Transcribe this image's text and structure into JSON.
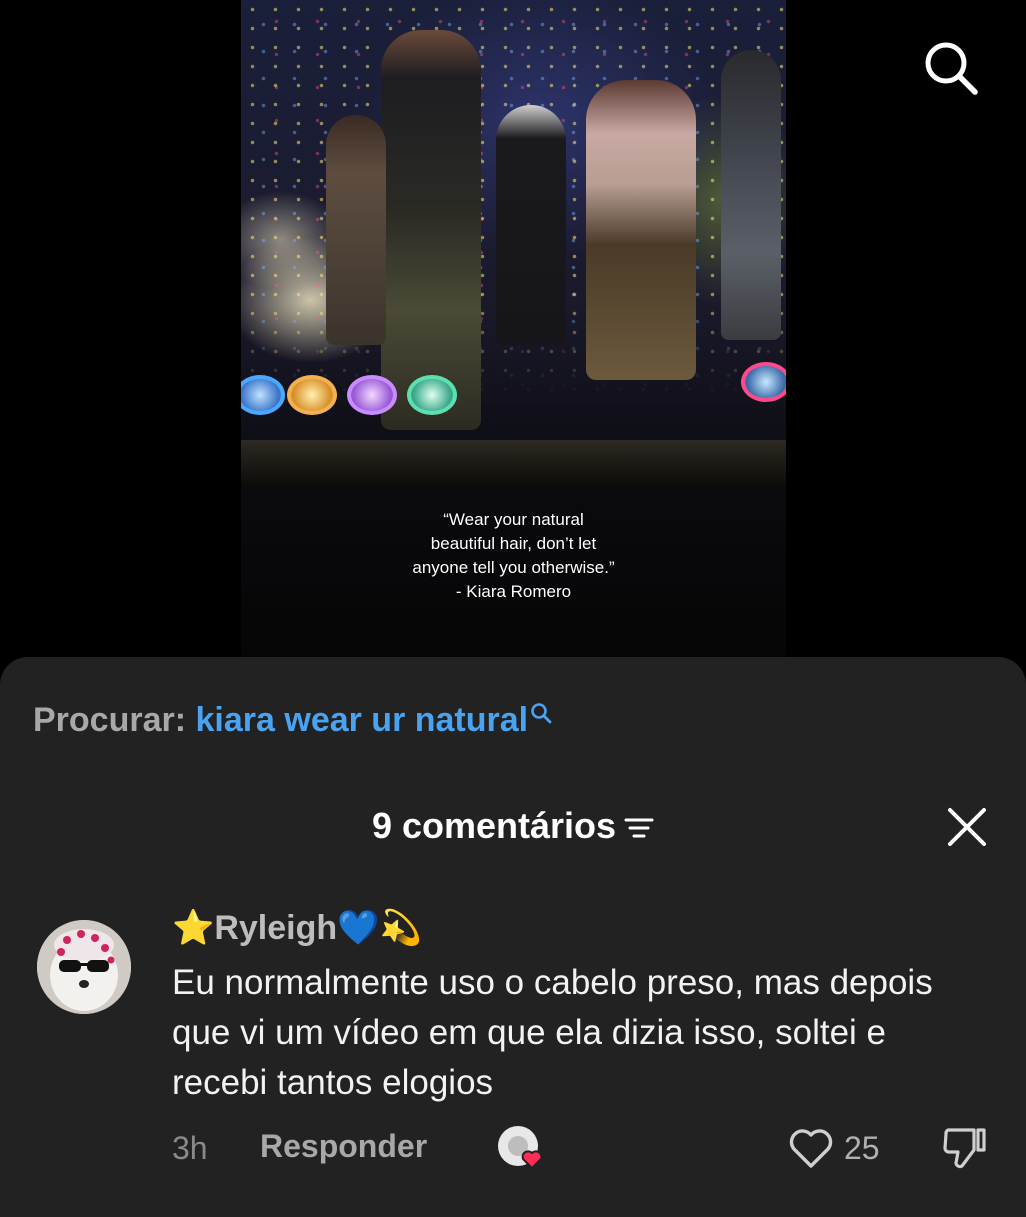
{
  "video": {
    "caption_lines": [
      "“Wear your natural",
      "beautiful hair, don’t let",
      "anyone tell you otherwise.”",
      "- Kiara Romero"
    ]
  },
  "top_bar": {
    "search_icon": "search-icon"
  },
  "search_suggestion": {
    "label": "Procurar:",
    "query": "kiara wear ur natural",
    "icon": "search-icon"
  },
  "comments_header": {
    "title": "9 comentários",
    "sort_icon": "filter-icon",
    "close_icon": "close-icon"
  },
  "comments": [
    {
      "username": "Ryleigh",
      "username_prefix": "⭐",
      "username_suffix": "💙💫",
      "text": "Eu normalmente uso o cabelo preso, mas depois que vi um vídeo em que ela dizia isso, soltei e recebi tantos elogios",
      "time": "3h",
      "reply_label": "Responder",
      "likes": "25"
    }
  ],
  "colors": {
    "sheet_bg": "#222222",
    "link_blue": "#4aa3f0",
    "like_heart": "#ff2c55"
  }
}
